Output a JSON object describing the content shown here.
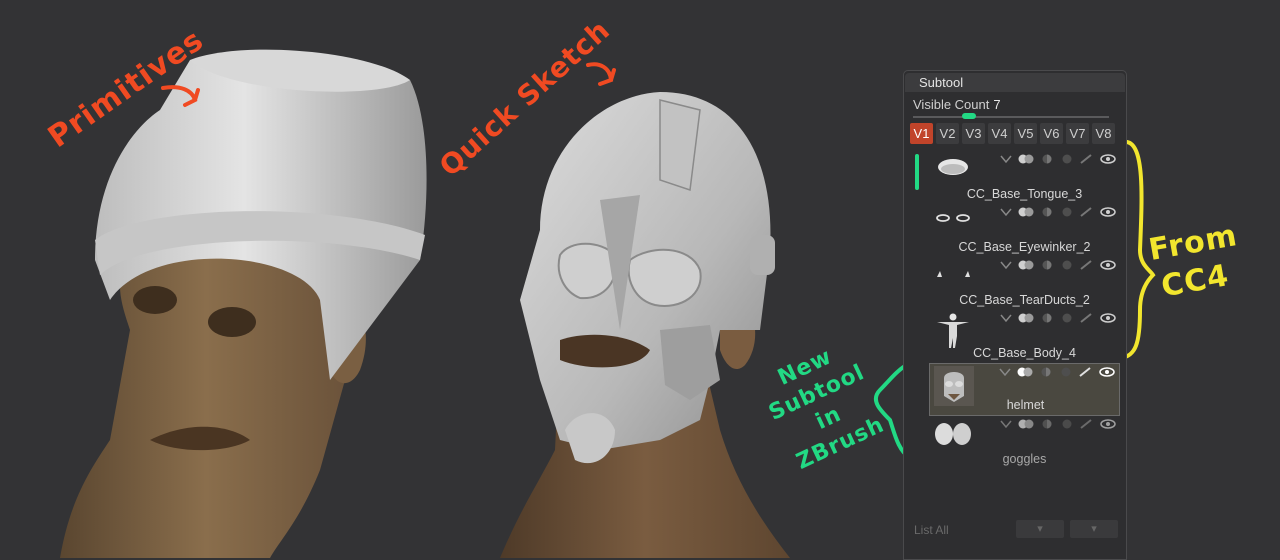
{
  "annotations": {
    "primitives": "Primitives",
    "quick_sketch": "Quick Sketch",
    "from_cc4_line1": "From",
    "from_cc4_line2": "CC4",
    "new_subtool_line1": "New",
    "new_subtool_line2": "Subtool in",
    "new_subtool_line3": "ZBrush"
  },
  "panel": {
    "title": "Subtool",
    "visible_count_label": "Visible Count",
    "visible_count_value": "7",
    "tabs": [
      "V1",
      "V2",
      "V3",
      "V4",
      "V5",
      "V6",
      "V7",
      "V8"
    ],
    "active_tab": "V1",
    "subtools": [
      {
        "name": "CC_Base_Tongue_3",
        "thumb": "tongue-thumbnail"
      },
      {
        "name": "CC_Base_Eyewinker_2",
        "thumb": "eyewinker-thumbnail"
      },
      {
        "name": "CC_Base_TearDucts_2",
        "thumb": "tearducts-thumbnail"
      },
      {
        "name": "CC_Base_Body_4",
        "thumb": "body-thumbnail"
      },
      {
        "name": "helmet",
        "thumb": "helmet-thumbnail",
        "selected": true
      },
      {
        "name": "goggles",
        "thumb": "goggles-thumbnail",
        "dim": true
      }
    ],
    "list_all": "List All"
  },
  "colors": {
    "orange_annotation": "#f04a22",
    "yellow_annotation": "#f2e62e",
    "green_annotation": "#22d984",
    "active_tab": "#c1442a"
  }
}
